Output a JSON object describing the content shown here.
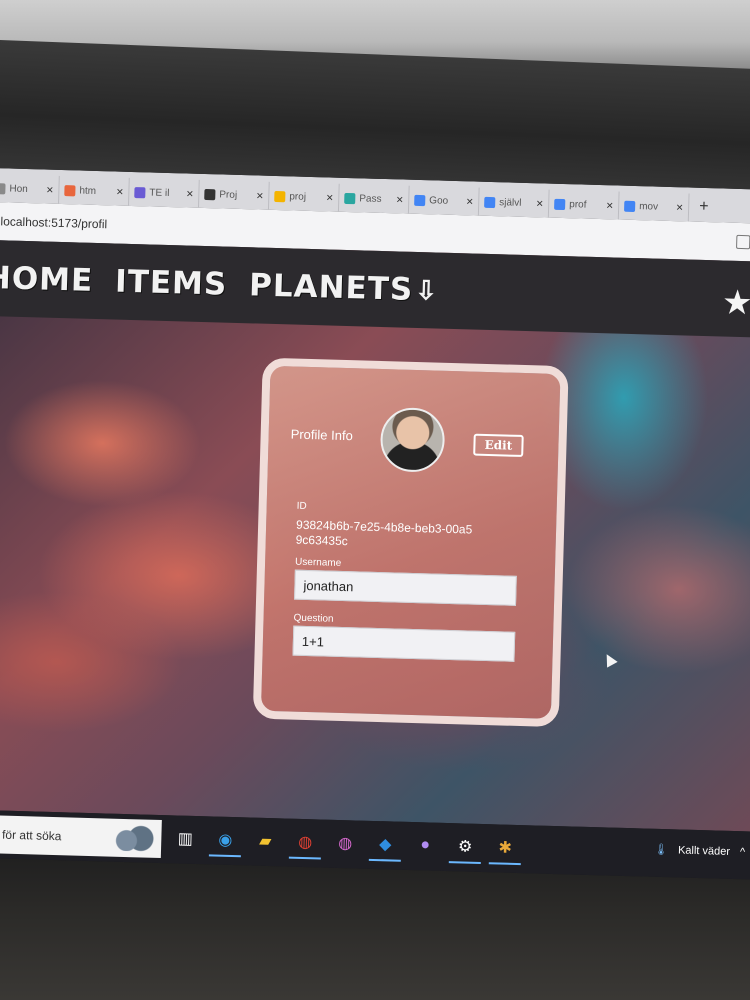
{
  "browser": {
    "tabs": [
      {
        "label": "Hon",
        "icon": "page-icon",
        "color": "#8a8a8a"
      },
      {
        "label": "htm",
        "icon": "html-icon",
        "color": "#e8663d"
      },
      {
        "label": "TE il",
        "icon": "teams-icon",
        "color": "#6a5bd4"
      },
      {
        "label": "Proj",
        "icon": "project-icon",
        "color": "#333333"
      },
      {
        "label": "proj",
        "icon": "slides-icon",
        "color": "#f4b400"
      },
      {
        "label": "Pass",
        "icon": "pass-icon",
        "color": "#2aa6a0"
      },
      {
        "label": "Goo",
        "icon": "docs-icon",
        "color": "#4285f4"
      },
      {
        "label": "självl",
        "icon": "google-icon",
        "color": "#4285f4"
      },
      {
        "label": "prof",
        "icon": "google-icon",
        "color": "#4285f4"
      },
      {
        "label": "mov",
        "icon": "google-icon",
        "color": "#4285f4"
      }
    ],
    "new_tab": "+",
    "url": "localhost:5173/profil"
  },
  "nav": {
    "home": "HOME",
    "items": "ITEMS",
    "planets": "PLANETS",
    "arrow": "⇩",
    "star": "★"
  },
  "profile": {
    "title": "Profile Info",
    "edit_label": "Edit",
    "id_label": "ID",
    "id_value": "93824b6b-7e25-4b8e-beb3-00a59c63435c",
    "username_label": "Username",
    "username_value": "jonathan",
    "question_label": "Question",
    "question_value": "1+1"
  },
  "taskbar": {
    "search_text": "här för att söka",
    "weather_text": "Kallt väder",
    "apps": [
      "task-view",
      "edge",
      "file-explorer",
      "chrome",
      "chrome-profile",
      "vscode",
      "github",
      "settings",
      "slack"
    ]
  }
}
